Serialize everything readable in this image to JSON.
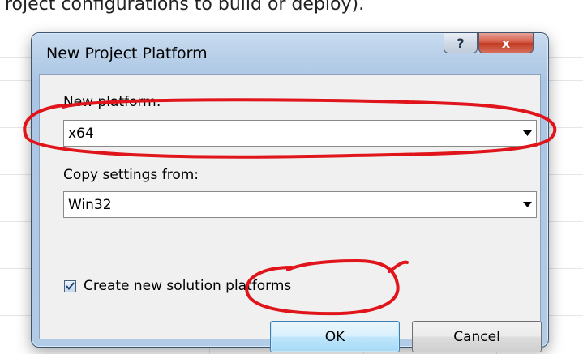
{
  "background": {
    "caption": "roject configurations to build or deploy)."
  },
  "dialog": {
    "title": "New Project Platform",
    "help_glyph": "?",
    "close_glyph": "x",
    "new_platform_label": "New platform:",
    "new_platform_value": "x64",
    "copy_settings_label": "Copy settings from:",
    "copy_settings_value": "Win32",
    "create_solution_platforms_label": "Create new solution platforms",
    "create_solution_platforms_checked": true,
    "ok_label": "OK",
    "cancel_label": "Cancel"
  },
  "colors": {
    "annotation": "#e0151b",
    "ok_accent": "#3c7fb1"
  },
  "icons": {
    "dropdown": "chevron-down-icon",
    "check": "checkmark-icon"
  }
}
